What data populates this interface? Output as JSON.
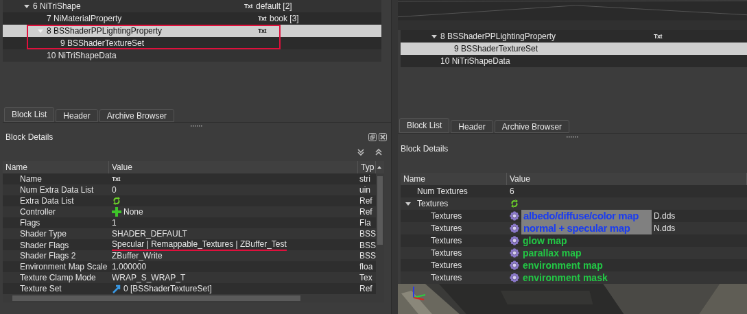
{
  "left_panel": {
    "tree": [
      {
        "label": "6 NiTriShape",
        "tag": "Txt",
        "value": "default [2]",
        "expanded": true,
        "selected": false,
        "children": [
          {
            "label": "7 NiMaterialProperty",
            "tag": "Txt",
            "value": "book [3]",
            "selected": false
          },
          {
            "label": "8 BSShaderPPLightingProperty",
            "tag": "Txt",
            "expanded": true,
            "selected": true,
            "annotated": true,
            "children": [
              {
                "label": "9 BSShaderTextureSet",
                "selected": false
              }
            ]
          },
          {
            "label": "10 NiTriShapeData",
            "selected": false
          }
        ]
      }
    ],
    "tabs": [
      {
        "label": "Block List",
        "selected": true
      },
      {
        "label": "Header",
        "selected": false
      },
      {
        "label": "Archive Browser",
        "selected": false
      }
    ],
    "details_title": "Block Details",
    "columns": [
      "Name",
      "Value",
      "Typ"
    ],
    "rows": [
      {
        "name": "Name",
        "tag": "Txt",
        "type": "stri"
      },
      {
        "name": "Num Extra Data List",
        "value": "0",
        "type": "uin"
      },
      {
        "name": "Extra Data List",
        "kind": "refresh",
        "type": "Ref"
      },
      {
        "name": "Controller",
        "kind": "plus",
        "value": "None",
        "type": "Ref"
      },
      {
        "name": "Flags",
        "value": "1",
        "type": "Fla"
      },
      {
        "name": "Shader Type",
        "value": "SHADER_DEFAULT",
        "type": "BSS"
      },
      {
        "name": "Shader Flags",
        "value": "Specular | Remappable_Textures | ZBuffer_Test",
        "type": "BSS",
        "underlined": true
      },
      {
        "name": "Shader Flags 2",
        "value": "ZBuffer_Write",
        "type": "BSS"
      },
      {
        "name": "Environment Map Scale",
        "value": "1.000000",
        "type": "floa"
      },
      {
        "name": "Texture Clamp Mode",
        "value": "WRAP_S_WRAP_T",
        "type": "Tex"
      },
      {
        "name": "Texture Set",
        "kind": "link",
        "value": "0 [BSShaderTextureSet]",
        "type": "Ref"
      }
    ]
  },
  "right_panel": {
    "tree": [
      {
        "label": "8 BSShaderPPLightingProperty",
        "tag": "Txt",
        "expanded": true,
        "selected": false,
        "children": [
          {
            "label": "9 BSShaderTextureSet",
            "selected": true
          }
        ]
      },
      {
        "label": "10 NiTriShapeData",
        "selected": false
      }
    ],
    "tabs": [
      {
        "label": "Block List",
        "selected": true
      },
      {
        "label": "Header",
        "selected": false
      },
      {
        "label": "Archive Browser",
        "selected": false
      }
    ],
    "details_title": "Block Details",
    "columns": [
      "Name",
      "Value"
    ],
    "rows": [
      {
        "name": "Num Textures",
        "value": "6"
      },
      {
        "name": "Textures",
        "kind": "refresh",
        "expanded": true,
        "children": [
          {
            "name": "Textures",
            "annotation": "albedo/diffuse/color map",
            "color": "#1a3cf0",
            "highlighted": true,
            "file_suffix": "D.dds"
          },
          {
            "name": "Textures",
            "annotation": "normal + specular map",
            "color": "#1a3cf0",
            "highlighted": true,
            "file_suffix": "N.dds"
          },
          {
            "name": "Textures",
            "annotation": "glow map",
            "color": "#22c845"
          },
          {
            "name": "Textures",
            "annotation": "parallax map",
            "color": "#22c845"
          },
          {
            "name": "Textures",
            "annotation": "environment map",
            "color": "#22c845"
          },
          {
            "name": "Textures",
            "annotation": "environment mask",
            "color": "#22c845"
          }
        ]
      }
    ]
  }
}
